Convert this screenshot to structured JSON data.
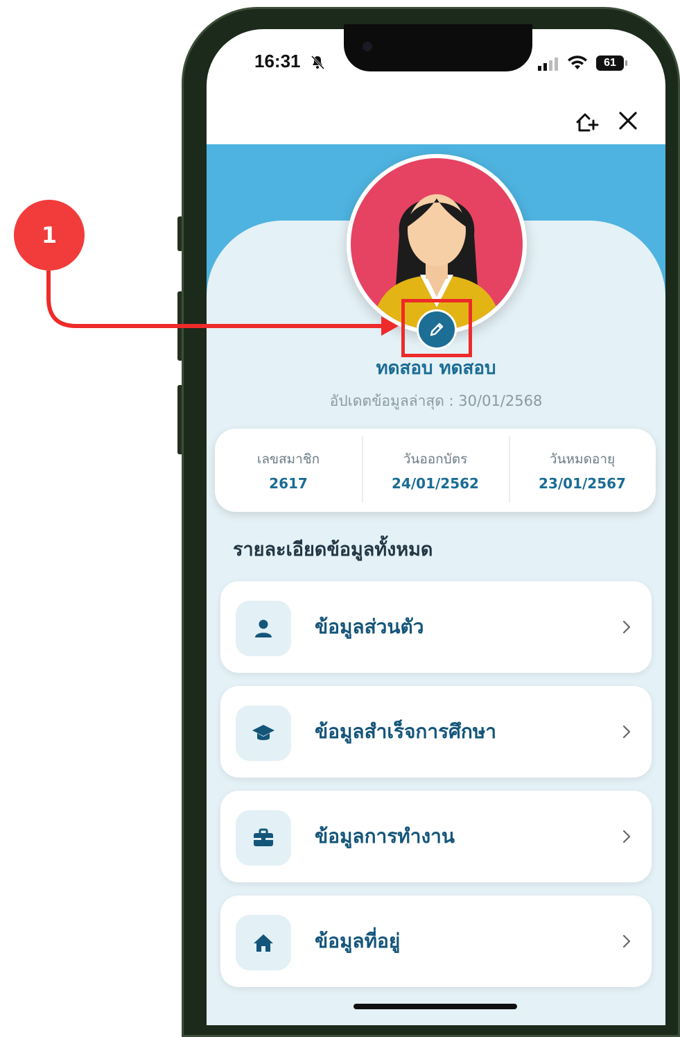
{
  "annotation": {
    "step_number": "1"
  },
  "status_bar": {
    "time": "16:31",
    "battery_level": "61"
  },
  "header": {
    "add_home_icon": "home-plus-icon",
    "close_icon": "close-icon"
  },
  "profile": {
    "name": "ทดสอบ ทดสอบ",
    "last_updated": "อัปเดตข้อมูลล่าสุด : 30/01/2568"
  },
  "info_card": {
    "items": [
      {
        "label": "เลขสมาชิก",
        "value": "2617"
      },
      {
        "label": "วันออกบัตร",
        "value": "24/01/2562"
      },
      {
        "label": "วันหมดอายุ",
        "value": "23/01/2567"
      }
    ]
  },
  "section_title": "รายละเอียดข้อมูลทั้งหมด",
  "menu": {
    "items": [
      {
        "label": "ข้อมูลส่วนตัว",
        "icon": "person-icon"
      },
      {
        "label": "ข้อมูลสำเร็จการศึกษา",
        "icon": "graduation-cap-icon"
      },
      {
        "label": "ข้อมูลการทำงาน",
        "icon": "briefcase-icon"
      },
      {
        "label": "ข้อมูลที่อยู่",
        "icon": "home-icon"
      }
    ]
  },
  "colors": {
    "accent": "#1a6c95",
    "header_band": "#4eb3e0",
    "panel_bg": "#e4f1f6",
    "callout": "#f23b3b"
  }
}
